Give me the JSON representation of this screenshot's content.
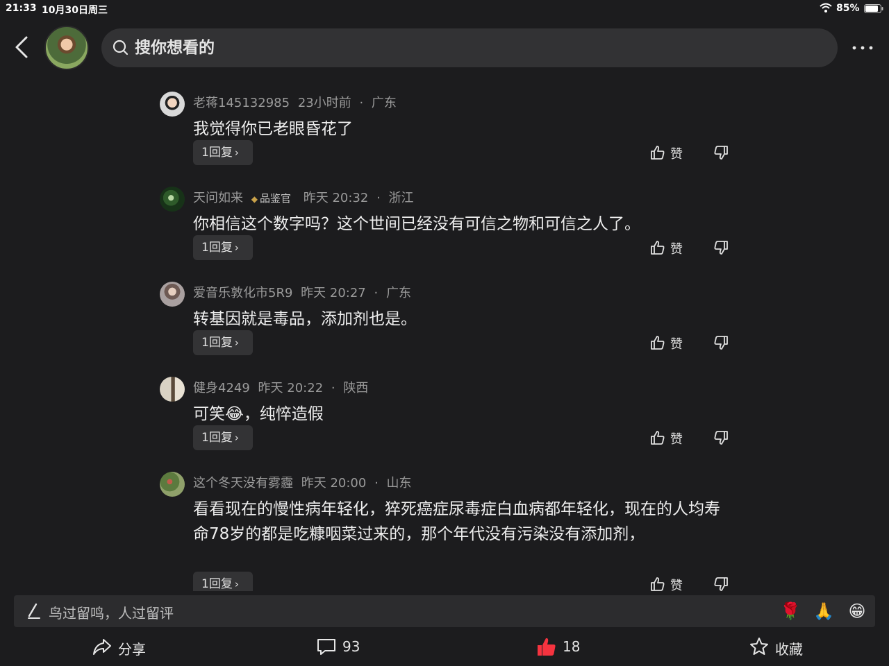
{
  "status_bar": {
    "time": "21:33",
    "date": "10月30日周三",
    "battery": "85%"
  },
  "search": {
    "placeholder": "搜你想看的"
  },
  "comments": [
    {
      "user": "老蒋145132985",
      "badge": "",
      "time": "23小时前",
      "location": "广东",
      "text": "我觉得你已老眼昏花了",
      "replies": "1回复",
      "like_label": "赞"
    },
    {
      "user": "天问如来",
      "badge": "品鉴官",
      "time": "昨天 20:32",
      "location": "浙江",
      "text": "你相信这个数字吗？这个世间已经没有可信之物和可信之人了。",
      "replies": "1回复",
      "like_label": "赞"
    },
    {
      "user": "爱音乐敦化市5R9",
      "badge": "",
      "time": "昨天 20:27",
      "location": "广东",
      "text": "转基因就是毒品，添加剂也是。",
      "replies": "1回复",
      "like_label": "赞"
    },
    {
      "user": "健身4249",
      "badge": "",
      "time": "昨天 20:22",
      "location": "陕西",
      "text": "可笑😂，纯悴造假",
      "replies": "1回复",
      "like_label": "赞"
    },
    {
      "user": "这个冬天没有雾霾",
      "badge": "",
      "time": "昨天 20:00",
      "location": "山东",
      "text": "看看现在的慢性病年轻化，猝死癌症尿毒症白血病都年轻化，现在的人均寿命78岁的都是吃糠咽菜过来的，那个年代没有污染没有添加剂，",
      "replies": "1回复",
      "like_label": "赞"
    }
  ],
  "comment_input": {
    "placeholder": "鸟过留鸣，人过留评",
    "emojis": [
      "🌹",
      "🙏",
      "😁"
    ]
  },
  "bottom_bar": {
    "share_label": "分享",
    "comment_count": "93",
    "like_count": "18",
    "favorite_label": "收藏"
  },
  "colors": {
    "background": "#1c1c1e",
    "like_active": "#f5333f"
  },
  "icons": [
    "back-icon",
    "search-icon",
    "more-icon",
    "thumb-up-icon",
    "thumb-down-icon",
    "pen-icon",
    "share-icon",
    "comment-icon",
    "star-icon"
  ]
}
